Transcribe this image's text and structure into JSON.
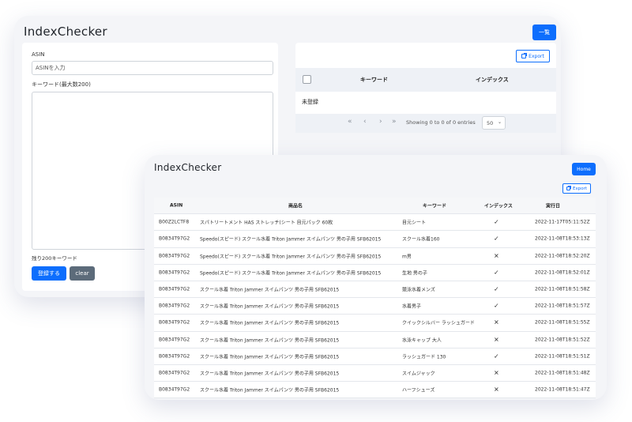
{
  "back_window": {
    "title": "IndexChecker",
    "list_button": "一覧",
    "asin_label": "ASIN",
    "asin_placeholder": "ASINを入力",
    "keyword_label": "キーワード(最大数200)",
    "remaining": "残り200キーワード",
    "register_button": "登録する",
    "clear_button": "clear",
    "export_button": "Export",
    "table_headers": [
      "キーワード",
      "インデックス"
    ],
    "empty_text": "未登録",
    "pager": {
      "first": "«",
      "prev": "‹",
      "next": "›",
      "last": "»",
      "showing": "Showing 0 to 0 of 0 entries",
      "page_size": "50"
    }
  },
  "front_window": {
    "title": "IndexChecker",
    "home_button": "Home",
    "export_button": "Export",
    "headers": {
      "asin": "ASIN",
      "name": "商品名",
      "keyword": "キーワード",
      "index": "インデックス",
      "date": "実行日"
    },
    "rows": [
      {
        "asin": "B00Z2LCTF8",
        "name": "スパトリートメント HAS ストレッチ(シート 目元パック 60枚",
        "keyword": "目元シート",
        "index": "✓",
        "date": "2022-11-17T05:11:52Z"
      },
      {
        "asin": "B0834T97G2",
        "name": "Speedo(スピード) スクール水着 Triton Jammer スイムパンツ 男の子用 SFB62015",
        "keyword": "スクール水着160",
        "index": "✓",
        "date": "2022-11-08T18:53:13Z"
      },
      {
        "asin": "B0834T97G2",
        "name": "Speedo(スピード) スクール水着 Triton Jammer スイムパンツ 男の子用 SFB62015",
        "keyword": "m男",
        "index": "✕",
        "date": "2022-11-08T18:52:20Z"
      },
      {
        "asin": "B0834T97G2",
        "name": "Speedo(スピード) スクール水着 Triton Jammer スイムパンツ 男の子用 SFB62015",
        "keyword": "生地 男の子",
        "index": "✓",
        "date": "2022-11-08T18:52:01Z"
      },
      {
        "asin": "B0834T97G2",
        "name": "スクール水着 Triton Jammer スイムパンツ 男の子用 SFB62015",
        "keyword": "競泳水着メンズ",
        "index": "✓",
        "date": "2022-11-08T18:51:58Z"
      },
      {
        "asin": "B0834T97G2",
        "name": "スクール水着 Triton Jammer スイムパンツ 男の子用 SFB62015",
        "keyword": "水着男子",
        "index": "✓",
        "date": "2022-11-08T18:51:57Z"
      },
      {
        "asin": "B0834T97G2",
        "name": "スクール水着 Triton Jammer スイムパンツ 男の子用 SFB62015",
        "keyword": "クイックシルバー ラッシュガード",
        "index": "✕",
        "date": "2022-11-08T18:51:55Z"
      },
      {
        "asin": "B0834T97G2",
        "name": "スクール水着 Triton Jammer スイムパンツ 男の子用 SFB62015",
        "keyword": "水泳キャップ 大人",
        "index": "✕",
        "date": "2022-11-08T18:51:52Z"
      },
      {
        "asin": "B0834T97G2",
        "name": "スクール水着 Triton Jammer スイムパンツ 男の子用 SFB62015",
        "keyword": "ラッシュガード 130",
        "index": "✓",
        "date": "2022-11-08T18:51:51Z"
      },
      {
        "asin": "B0834T97G2",
        "name": "スクール水着 Triton Jammer スイムパンツ 男の子用 SFB62015",
        "keyword": "スイムジャック",
        "index": "✕",
        "date": "2022-11-08T18:51:48Z"
      },
      {
        "asin": "B0834T97G2",
        "name": "スクール水着 Triton Jammer スイムパンツ 男の子用 SFB62015",
        "keyword": "ハーフシューズ",
        "index": "✕",
        "date": "2022-11-08T18:51:47Z"
      }
    ]
  }
}
